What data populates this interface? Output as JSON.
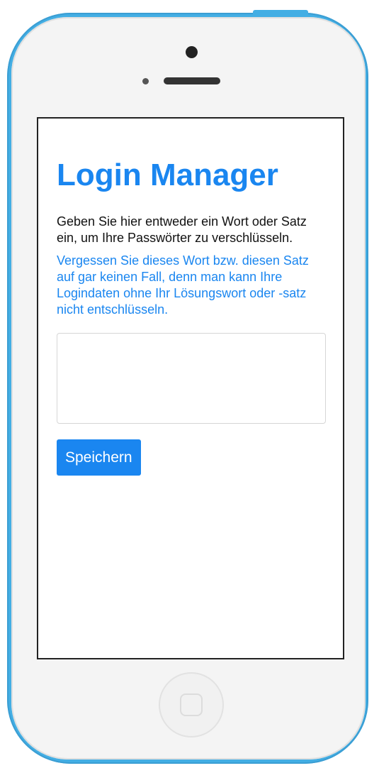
{
  "app": {
    "title": "Login Manager",
    "intro_text": "Geben Sie hier entweder ein Wort oder Satz ein, um Ihre Passwörter zu verschlüsseln.",
    "warning_text": "Vergessen Sie dieses Wort bzw. diesen Satz auf gar keinen Fall, denn man kann Ihre Logindaten ohne Ihr Lösungswort oder -satz nicht entschlüsseln.",
    "passphrase": {
      "value": "",
      "placeholder": ""
    },
    "save_label": "Speichern"
  },
  "colors": {
    "accent": "#1a86f0",
    "phone_frame": "#43aee4",
    "text": "#111111"
  },
  "icons": {
    "home": "home-button-icon",
    "camera": "front-camera-icon",
    "speaker": "speaker-grille-icon"
  }
}
